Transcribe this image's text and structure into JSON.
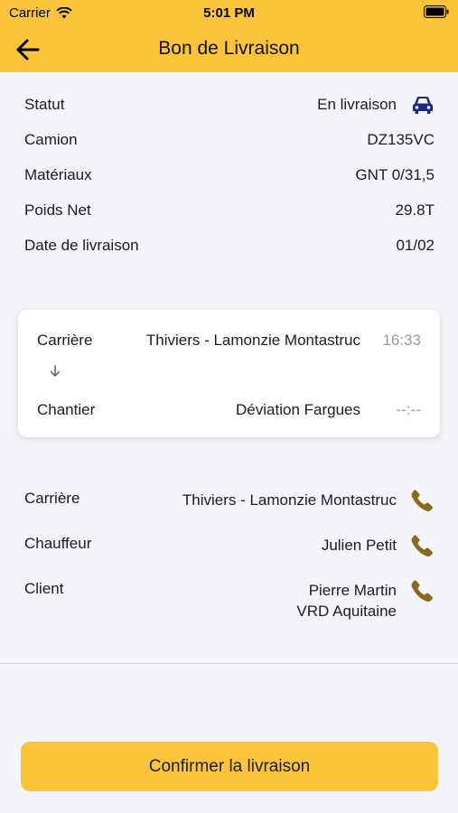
{
  "status_bar": {
    "carrier": "Carrier",
    "time": "5:01 PM"
  },
  "nav": {
    "title": "Bon de Livraison"
  },
  "info": {
    "statut": {
      "label": "Statut",
      "value": "En livraison"
    },
    "camion": {
      "label": "Camion",
      "value": "DZ135VC"
    },
    "materiaux": {
      "label": "Matériaux",
      "value": "GNT 0/31,5"
    },
    "poids": {
      "label": "Poids Net",
      "value": "29.8T"
    },
    "date": {
      "label": "Date de livraison",
      "value": "01/02"
    }
  },
  "route": {
    "origin": {
      "label": "Carrière",
      "place": "Thiviers - Lamonzie Montastruc",
      "time": "16:33"
    },
    "destination": {
      "label": "Chantier",
      "place": "Déviation Fargues",
      "time": "--:--"
    }
  },
  "contacts": {
    "carriere": {
      "label": "Carrière",
      "value": "Thiviers - Lamonzie Montastruc"
    },
    "chauffeur": {
      "label": "Chauffeur",
      "value": "Julien Petit"
    },
    "client": {
      "label": "Client",
      "line1": "Pierre Martin",
      "line2": "VRD Aquitaine"
    }
  },
  "confirm": {
    "label": "Confirmer la livraison"
  },
  "colors": {
    "accent": "#fbc43a",
    "phone": "#8a6a20",
    "car": "#1b2a8a",
    "background": "#f3f5f9"
  }
}
